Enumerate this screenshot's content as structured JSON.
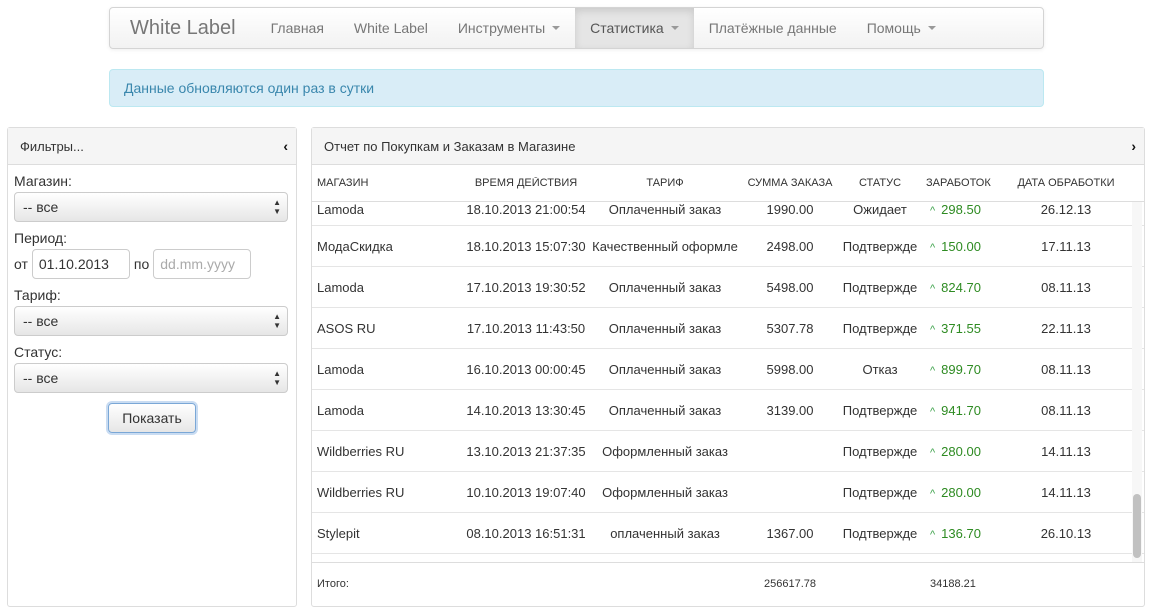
{
  "navbar": {
    "brand": "White Label",
    "items": [
      {
        "label": "Главная",
        "dropdown": false,
        "active": false
      },
      {
        "label": "White Label",
        "dropdown": false,
        "active": false
      },
      {
        "label": "Инструменты",
        "dropdown": true,
        "active": false
      },
      {
        "label": "Статистика",
        "dropdown": true,
        "active": true
      },
      {
        "label": "Платёжные данные",
        "dropdown": false,
        "active": false
      },
      {
        "label": "Помощь",
        "dropdown": true,
        "active": false
      }
    ]
  },
  "alert": {
    "text": "Данные обновляются один раз в сутки"
  },
  "filters": {
    "title": "Фильтры...",
    "toggle": "‹",
    "shop_label": "Магазин:",
    "shop_value": "-- все",
    "period_label": "Период:",
    "from_label": "от",
    "from_value": "01.10.2013",
    "to_label": "по",
    "to_placeholder": "dd.mm.yyyy",
    "tariff_label": "Тариф:",
    "tariff_value": "-- все",
    "status_label": "Статус:",
    "status_value": "-- все",
    "submit_label": "Показать"
  },
  "report": {
    "title": "Отчет по Покупкам и Заказам в Магазине",
    "toggle": "›",
    "columns": {
      "shop": "Магазин",
      "time": "Время действия",
      "tariff": "Тариф",
      "sum": "Сумма заказа",
      "status": "Статус",
      "earn": "Заработок",
      "date": "Дата обработки"
    },
    "rows": [
      {
        "shop": "Lamoda",
        "time": "18.10.2013 21:00:54",
        "tariff": "Оплаченный заказ",
        "sum": "1990.00",
        "status": "Ожидает",
        "earn": "298.50",
        "date": "26.12.13"
      },
      {
        "shop": "МодаСкидка",
        "time": "18.10.2013 15:07:30",
        "tariff": "Качественный оформле",
        "sum": "2498.00",
        "status": "Подтвержде",
        "earn": "150.00",
        "date": "17.11.13"
      },
      {
        "shop": "Lamoda",
        "time": "17.10.2013 19:30:52",
        "tariff": "Оплаченный заказ",
        "sum": "5498.00",
        "status": "Подтвержде",
        "earn": "824.70",
        "date": "08.11.13"
      },
      {
        "shop": "ASOS RU",
        "time": "17.10.2013 11:43:50",
        "tariff": "Оплаченный заказ",
        "sum": "5307.78",
        "status": "Подтвержде",
        "earn": "371.55",
        "date": "22.11.13"
      },
      {
        "shop": "Lamoda",
        "time": "16.10.2013 00:00:45",
        "tariff": "Оплаченный заказ",
        "sum": "5998.00",
        "status": "Отказ",
        "earn": "899.70",
        "date": "08.11.13"
      },
      {
        "shop": "Lamoda",
        "time": "14.10.2013 13:30:45",
        "tariff": "Оплаченный заказ",
        "sum": "3139.00",
        "status": "Подтвержде",
        "earn": "941.70",
        "date": "08.11.13"
      },
      {
        "shop": "Wildberries RU",
        "time": "13.10.2013 21:37:35",
        "tariff": "Оформленный заказ",
        "sum": "",
        "status": "Подтвержде",
        "earn": "280.00",
        "date": "14.11.13"
      },
      {
        "shop": "Wildberries RU",
        "time": "10.10.2013 19:07:40",
        "tariff": "Оформленный заказ",
        "sum": "",
        "status": "Подтвержде",
        "earn": "280.00",
        "date": "14.11.13"
      },
      {
        "shop": "Stylepit",
        "time": "08.10.2013 16:51:31",
        "tariff": "оплаченный заказ",
        "sum": "1367.00",
        "status": "Подтвержде",
        "earn": "136.70",
        "date": "26.10.13"
      }
    ],
    "totals": {
      "label": "Итого:",
      "sum": "256617.78",
      "earn": "34188.21"
    }
  },
  "icons": {
    "caret": "caret-down-icon",
    "up": "chevron-up-icon",
    "select": "select-arrows-icon"
  },
  "colors": {
    "accent_green": "#2e8b22",
    "alert_bg": "#d9edf7",
    "alert_text": "#3a87ad"
  }
}
